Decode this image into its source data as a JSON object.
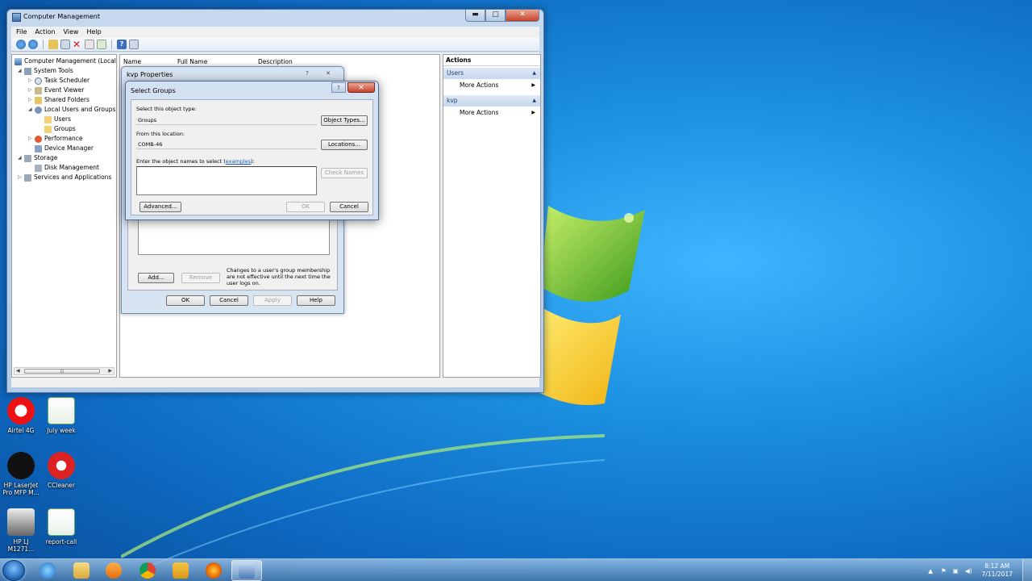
{
  "main_window": {
    "title": "Computer Management",
    "caption": {
      "minimize": "▬",
      "maximize": "▢",
      "close": "✕"
    },
    "menu": [
      "File",
      "Action",
      "View",
      "Help"
    ],
    "tree": {
      "root": "Computer Management (Local",
      "system_tools": "System Tools",
      "task_scheduler": "Task Scheduler",
      "event_viewer": "Event Viewer",
      "shared_folders": "Shared Folders",
      "local_users": "Local Users and Groups",
      "users": "Users",
      "groups": "Groups",
      "performance": "Performance",
      "device_manager": "Device Manager",
      "storage": "Storage",
      "disk_management": "Disk Management",
      "services": "Services and Applications"
    },
    "columns": {
      "name": "Name",
      "full_name": "Full Name",
      "description": "Description"
    },
    "actions": {
      "header": "Actions",
      "section1": "Users",
      "more1": "More Actions",
      "section2": "kvp",
      "more2": "More Actions"
    }
  },
  "kvp_dialog": {
    "title": "kvp Properties",
    "add": "Add...",
    "remove": "Remove",
    "note": "Changes to a user's group membership are not effective until the next time the user logs on.",
    "ok": "OK",
    "cancel": "Cancel",
    "apply": "Apply",
    "help": "Help"
  },
  "select_groups": {
    "title": "Select Groups",
    "help_btn": "?",
    "close_btn": "✕",
    "object_type_label": "Select this object type:",
    "object_type_value": "Groups",
    "object_types_btn": "Object Types...",
    "location_label": "From this location:",
    "location_value": "COMB-46",
    "locations_btn": "Locations...",
    "names_label": "Enter the object names to select (",
    "names_link": "examples",
    "names_label_end": "):",
    "names_value": "",
    "check_names_btn": "Check Names",
    "advanced_btn": "Advanced...",
    "ok_btn": "OK",
    "cancel_btn": "Cancel"
  },
  "desktop_icons": [
    {
      "label": "Airtel 4G"
    },
    {
      "label": "July week"
    },
    {
      "label": "HP LaserJet Pro MFP M..."
    },
    {
      "label": "CCleaner"
    },
    {
      "label": "HP LJ M1271..."
    },
    {
      "label": "report-call"
    }
  ],
  "clock": {
    "time": "8:12 AM",
    "date": "7/11/2017"
  }
}
